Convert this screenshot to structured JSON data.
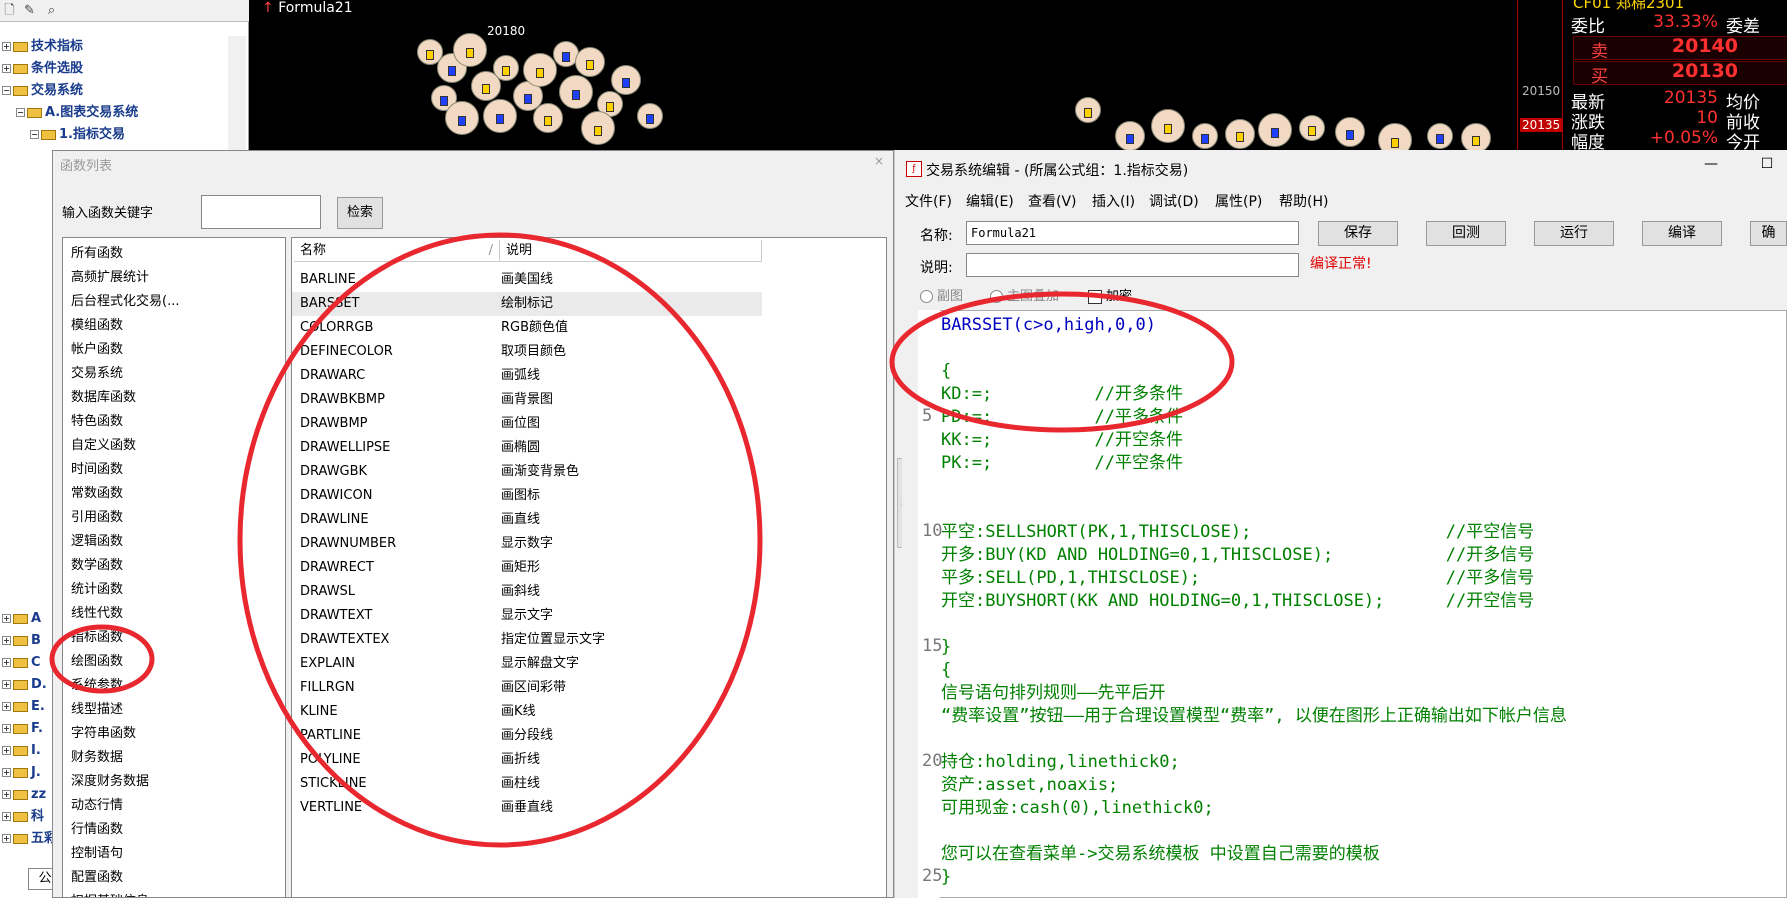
{
  "left_tree": {
    "items": [
      {
        "label": "技术指标"
      },
      {
        "label": "条件选股"
      },
      {
        "label": "交易系统"
      },
      {
        "label": "A.图表交易系统"
      },
      {
        "label": "1.指标交易"
      }
    ],
    "lower_stubs": [
      "A",
      "B",
      "C",
      "D.",
      "E.",
      "F.",
      "I.",
      "J.",
      "zz",
      "科",
      "五彩"
    ],
    "tab_label": "公"
  },
  "chart": {
    "title": "Formula21",
    "price_label": "20180",
    "axis_labels": [
      "20150",
      "20135"
    ],
    "bg_color": "#000000"
  },
  "quote": {
    "rows": [
      {
        "label": "委比",
        "value": "33.33%",
        "extra": "委差"
      },
      {
        "label": "卖",
        "value": "20140"
      },
      {
        "label": "买",
        "value": "20130"
      },
      {
        "label": "最新",
        "value": "20135",
        "extra": "均价"
      },
      {
        "label": "涨跌",
        "value": "10",
        "extra": "前收"
      },
      {
        "label": "幅度",
        "value": "+0.05%",
        "extra": "今开"
      }
    ],
    "header_partial": "CF01 郑棉2301"
  },
  "fn_dialog": {
    "title": "函数列表",
    "close": "×",
    "search_label": "输入函数关键字",
    "search_value": "",
    "search_button": "检索",
    "categories": [
      "所有函数",
      "高频扩展统计",
      "后台程式化交易(...",
      "模组函数",
      "帐户函数",
      "交易系统",
      "数据库函数",
      "特色函数",
      "自定义函数",
      "时间函数",
      "常数函数",
      "引用函数",
      "逻辑函数",
      "数学函数",
      "统计函数",
      "线性代数",
      "指标函数",
      "绘图函数",
      "系统参数",
      "线型描述",
      "字符串函数",
      "财务数据",
      "深度财务数据",
      "动态行情",
      "行情函数",
      "控制语句",
      "配置函数",
      "扣据基础信息"
    ],
    "col_name": "名称",
    "col_desc": "说明",
    "functions": [
      {
        "name": "BARLINE",
        "desc": "画美国线"
      },
      {
        "name": "BARSSET",
        "desc": "绘制标记"
      },
      {
        "name": "COLORRGB",
        "desc": "RGB颜色值"
      },
      {
        "name": "DEFINECOLOR",
        "desc": "取项目颜色"
      },
      {
        "name": "DRAWARC",
        "desc": "画弧线"
      },
      {
        "name": "DRAWBKBMP",
        "desc": "画背景图"
      },
      {
        "name": "DRAWBMP",
        "desc": "画位图"
      },
      {
        "name": "DRAWELLIPSE",
        "desc": "画椭圆"
      },
      {
        "name": "DRAWGBK",
        "desc": "画渐变背景色"
      },
      {
        "name": "DRAWICON",
        "desc": "画图标"
      },
      {
        "name": "DRAWLINE",
        "desc": "画直线"
      },
      {
        "name": "DRAWNUMBER",
        "desc": "显示数字"
      },
      {
        "name": "DRAWRECT",
        "desc": "画矩形"
      },
      {
        "name": "DRAWSL",
        "desc": "画斜线"
      },
      {
        "name": "DRAWTEXT",
        "desc": "显示文字"
      },
      {
        "name": "DRAWTEXTEX",
        "desc": "指定位置显示文字"
      },
      {
        "name": "EXPLAIN",
        "desc": "显示解盘文字"
      },
      {
        "name": "FILLRGN",
        "desc": "画区间彩带"
      },
      {
        "name": "KLINE",
        "desc": "画K线"
      },
      {
        "name": "PARTLINE",
        "desc": "画分段线"
      },
      {
        "name": "POLYLINE",
        "desc": "画折线"
      },
      {
        "name": "STICKLINE",
        "desc": "画柱线"
      },
      {
        "name": "VERTLINE",
        "desc": "画垂直线"
      }
    ]
  },
  "editor": {
    "title": "交易系统编辑 - (所属公式组：1.指标交易)",
    "min": "—",
    "max": "☐",
    "menus": [
      "文件(F)",
      "编辑(E)",
      "查看(V)",
      "插入(I)",
      "调试(D)",
      "属性(P)",
      "帮助(H)"
    ],
    "name_label": "名称:",
    "name_value": "Formula21",
    "desc_label": "说明:",
    "desc_value": "",
    "buttons": [
      "保存",
      "回测",
      "运行",
      "编译",
      "确"
    ],
    "compile_status": "编译正常!",
    "opt_sub": "副图",
    "opt_main": "主图叠加",
    "opt_encrypt": "加密",
    "line_numbers": [
      "5",
      "10",
      "15",
      "20",
      "25"
    ],
    "code_lines": [
      "BARSSET(c>o,high,0,0)",
      "",
      "{",
      "KD:=;          //开多条件",
      "PD:=;          //平多条件",
      "KK:=;          //开空条件",
      "PK:=;          //平空条件",
      "",
      "",
      "平空:SELLSHORT(PK,1,THISCLOSE);                   //平空信号",
      "开多:BUY(KD AND HOLDING=0,1,THISCLOSE);           //开多信号",
      "平多:SELL(PD,1,THISCLOSE);                        //平多信号",
      "开空:BUYSHORT(KK AND HOLDING=0,1,THISCLOSE);      //开空信号",
      "",
      "}",
      "{",
      "信号语句排列规则——先平后开",
      "“费率设置”按钮——用于合理设置模型“费率”, 以便在图形上正确输出如下帐户信息",
      "",
      "持仓:holding,linethick0;",
      "资产:asset,noaxis;",
      "可用现金:cash(0),linethick0;",
      "",
      "您可以在查看菜单->交易系统模板 中设置自己需要的模板",
      "}"
    ]
  },
  "annotation_color": "#e8282e"
}
